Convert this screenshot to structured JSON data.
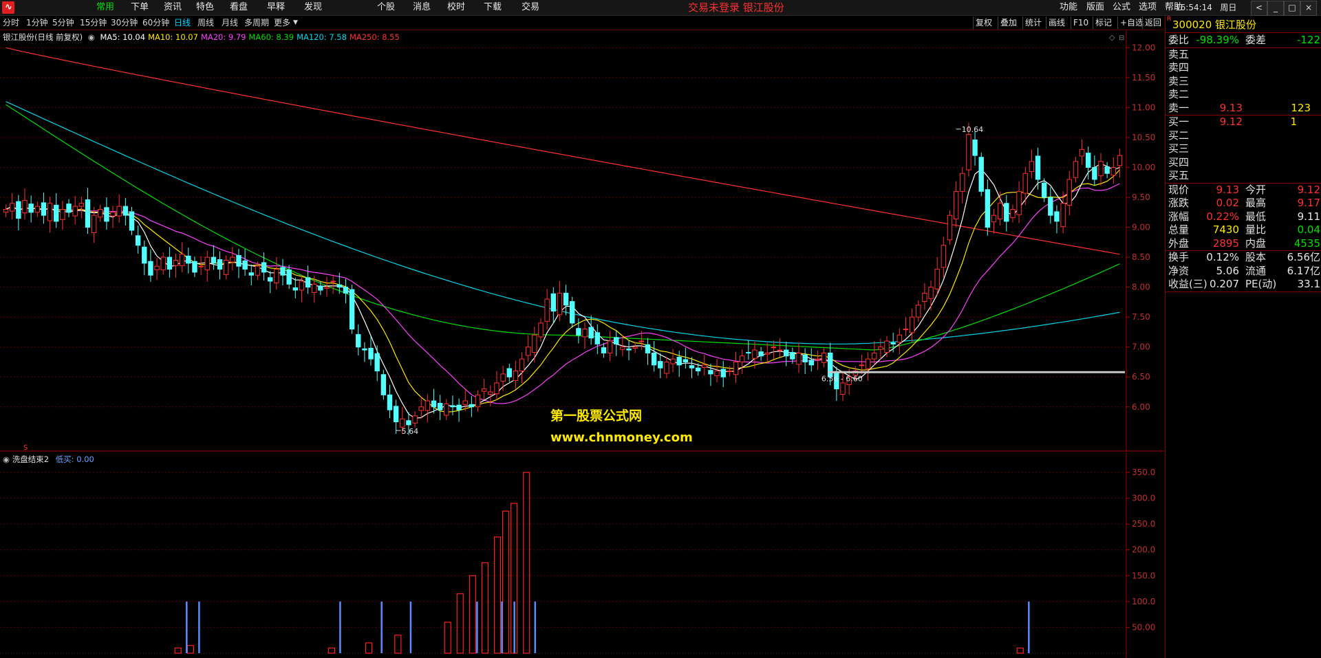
{
  "menubar": {
    "left_items": [
      "常用",
      "下单",
      "资讯",
      "特色",
      "看盘",
      "早释",
      "发现",
      "个股",
      "消息",
      "校时",
      "下载",
      "交易"
    ],
    "active": "常用",
    "center_title": "交易未登录   银江股份",
    "right_items": [
      "功能",
      "版面",
      "公式",
      "选项",
      "帮助"
    ],
    "clock": "16:54:14",
    "weekday": "周日",
    "window_buttons": [
      "<",
      "_",
      "□",
      "×"
    ]
  },
  "periods": {
    "items": [
      "分时",
      "1分钟",
      "5分钟",
      "15分钟",
      "30分钟",
      "60分钟",
      "日线",
      "周线",
      "月线",
      "多周期",
      "更多"
    ],
    "active": "日线"
  },
  "chart_tools": [
    "复权",
    "叠加",
    "统计",
    "画线",
    "F10",
    "标记",
    "+自选",
    "返回"
  ],
  "main_legend": {
    "stock": "银江股份(日线 前复权)",
    "ma": [
      {
        "label": "MA5: 10.04",
        "color": "#ffffff"
      },
      {
        "label": "MA10: 10.07",
        "color": "#ffea00"
      },
      {
        "label": "MA20: 9.79",
        "color": "#ff40ff"
      },
      {
        "label": "MA60: 8.39",
        "color": "#00e000"
      },
      {
        "label": "MA120: 7.58",
        "color": "#00d8e8"
      },
      {
        "label": "MA250: 8.55",
        "color": "#ff3030"
      }
    ]
  },
  "indicator_legend": {
    "name": "洗盘结束2",
    "value_label": "低买: 0.00"
  },
  "watermark": {
    "line1": "第一股票公式网",
    "line2": "www.chnmoney.com"
  },
  "price_annotations": {
    "high": "10.64",
    "low": "5.64",
    "range": "6.56 - 6.60",
    "signal": "S"
  },
  "chart_data": [
    {
      "type": "candlestick",
      "title": "银江股份(日线 前复权)",
      "yticks": [
        "12.00",
        "11.50",
        "11.00",
        "10.50",
        "10.00",
        "9.50",
        "9.00",
        "8.50",
        "8.00",
        "7.50",
        "7.00",
        "6.50",
        "6.00"
      ],
      "ylim": [
        5.4,
        12.2
      ],
      "n_bars": 175,
      "price_path_close": [
        9.3,
        9.4,
        9.15,
        9.45,
        9.25,
        9.35,
        9.2,
        9.4,
        9.1,
        9.3,
        9.25,
        9.35,
        9.4,
        9.0,
        9.2,
        9.3,
        9.1,
        9.25,
        9.35,
        9.2,
        8.95,
        8.7,
        8.4,
        8.2,
        8.35,
        8.5,
        8.3,
        8.45,
        8.55,
        8.4,
        8.25,
        8.35,
        8.5,
        8.4,
        8.3,
        8.45,
        8.5,
        8.35,
        8.3,
        8.2,
        8.35,
        8.25,
        8.1,
        8.3,
        8.2,
        8.05,
        7.95,
        8.1,
        8.0,
        8.05,
        7.95,
        8.0,
        8.1,
        8.0,
        7.9,
        7.3,
        7.0,
        6.95,
        6.8,
        6.6,
        6.2,
        5.95,
        5.75,
        5.8,
        5.7,
        5.85,
        6.0,
        6.1,
        6.0,
        5.95,
        6.05,
        6.0,
        5.95,
        6.1,
        6.0,
        6.2,
        6.3,
        6.25,
        6.4,
        6.55,
        6.5,
        6.6,
        6.8,
        7.0,
        7.2,
        7.4,
        7.8,
        7.6,
        7.9,
        7.7,
        7.4,
        7.2,
        7.3,
        7.15,
        7.05,
        6.9,
        7.1,
        7.05,
        7.0,
        6.95,
        7.0,
        7.1,
        6.9,
        6.7,
        6.65,
        6.75,
        6.8,
        6.7,
        6.75,
        6.65,
        6.6,
        6.7,
        6.55,
        6.6,
        6.5,
        6.6,
        6.75,
        6.85,
        6.9,
        6.95,
        6.85,
        6.9,
        7.0,
        6.95,
        6.85,
        6.8,
        6.9,
        6.75,
        6.7,
        6.8,
        6.9,
        6.5,
        6.3,
        6.4,
        6.5,
        6.6,
        6.7,
        6.8,
        6.9,
        7.0,
        7.1,
        7.05,
        7.2,
        7.3,
        7.5,
        7.7,
        7.9,
        8.0,
        8.3,
        8.7,
        9.2,
        9.6,
        9.9,
        10.55,
        10.2,
        9.6,
        9.0,
        9.2,
        9.4,
        9.1,
        9.3,
        9.6,
        9.9,
        10.1,
        9.8,
        9.5,
        9.2,
        9.1,
        9.4,
        9.8,
        10.1,
        10.3,
        10.0,
        9.8,
        10.1,
        9.9,
        10.0,
        10.2
      ],
      "ma5": 10.04,
      "ma10": 10.07,
      "ma20": 9.79,
      "ma60": 8.39,
      "ma120": 7.58,
      "ma250": 8.55
    },
    {
      "type": "bar",
      "title": "洗盘结束2",
      "yticks": [
        "350.0",
        "300.0",
        "250.0",
        "200.0",
        "150.0",
        "100.0",
        "50.00"
      ],
      "ylim": [
        0,
        370
      ],
      "red_bars": [
        [
          42,
          10
        ],
        [
          45,
          15
        ],
        [
          79,
          10
        ],
        [
          88,
          20
        ],
        [
          95,
          35
        ],
        [
          107,
          60
        ],
        [
          110,
          115
        ],
        [
          113,
          150
        ],
        [
          116,
          175
        ],
        [
          119,
          225
        ],
        [
          121,
          275
        ],
        [
          123,
          290
        ],
        [
          126,
          350
        ],
        [
          245,
          10
        ]
      ],
      "blue_bars": [
        [
          44,
          100
        ],
        [
          47,
          100
        ],
        [
          81,
          100
        ],
        [
          91,
          100
        ],
        [
          98,
          100
        ],
        [
          114,
          100
        ],
        [
          120,
          100
        ],
        [
          123,
          100
        ],
        [
          128,
          100
        ],
        [
          247,
          100
        ]
      ]
    }
  ],
  "quote_panel": {
    "code": "300020 银江股份",
    "weibi": {
      "label": "委比",
      "value": "-98.39%",
      "label2": "委差",
      "value2": "-122"
    },
    "sell": [
      {
        "label": "卖五",
        "price": "",
        "vol": ""
      },
      {
        "label": "卖四",
        "price": "",
        "vol": ""
      },
      {
        "label": "卖三",
        "price": "",
        "vol": ""
      },
      {
        "label": "卖二",
        "price": "",
        "vol": ""
      },
      {
        "label": "卖一",
        "price": "9.13",
        "vol": "123"
      }
    ],
    "buy": [
      {
        "label": "买一",
        "price": "9.12",
        "vol": "1"
      },
      {
        "label": "买二",
        "price": "",
        "vol": ""
      },
      {
        "label": "买三",
        "price": "",
        "vol": ""
      },
      {
        "label": "买四",
        "price": "",
        "vol": ""
      },
      {
        "label": "买五",
        "price": "",
        "vol": ""
      }
    ],
    "stats1": [
      {
        "l1": "现价",
        "v1": "9.13",
        "c1": "red",
        "l2": "今开",
        "v2": "9.12",
        "c2": "red"
      },
      {
        "l1": "涨跌",
        "v1": "0.02",
        "c1": "red",
        "l2": "最高",
        "v2": "9.17",
        "c2": "red"
      },
      {
        "l1": "涨幅",
        "v1": "0.22%",
        "c1": "red",
        "l2": "最低",
        "v2": "9.11",
        "c2": "white"
      },
      {
        "l1": "总量",
        "v1": "7430",
        "c1": "yellow",
        "l2": "量比",
        "v2": "0.04",
        "c2": "green"
      },
      {
        "l1": "外盘",
        "v1": "2895",
        "c1": "red",
        "l2": "内盘",
        "v2": "4535",
        "c2": "green"
      }
    ],
    "stats2": [
      {
        "l1": "换手",
        "v1": "0.12%",
        "l2": "股本",
        "v2": "6.56亿"
      },
      {
        "l1": "净资",
        "v1": "5.06",
        "l2": "流通",
        "v2": "6.17亿"
      },
      {
        "l1": "收益(三)",
        "v1": "0.207",
        "l2": "PE(动)",
        "v2": "33.1"
      }
    ]
  }
}
